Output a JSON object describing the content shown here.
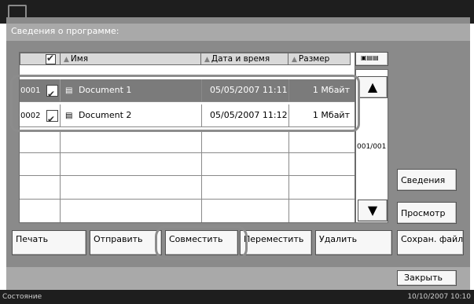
{
  "window": {
    "title": "Сведения о программе:"
  },
  "list": {
    "headers": {
      "name": "Имя",
      "datetime": "Дата и время",
      "size": "Размер"
    },
    "rows": [
      {
        "number": "0001",
        "checked": true,
        "name": "Document 1",
        "datetime": "05/05/2007 11:11",
        "size": "1 Мбайт",
        "selected": true
      },
      {
        "number": "0002",
        "checked": true,
        "name": "Document 2",
        "datetime": "05/05/2007 11:12",
        "size": "1 Мбайт",
        "selected": false
      }
    ],
    "page_indicator": "001/001"
  },
  "side_buttons": {
    "details": "Сведения",
    "preview": "Просмотр"
  },
  "action_buttons": {
    "print": "Печать",
    "send": "Отправить",
    "combine": "Совместить",
    "move": "Переместить",
    "delete": "Удалить",
    "save_file": "Сохран. файл"
  },
  "close_button": "Закрыть",
  "status": {
    "label": "Состояние",
    "datetime": "10/10/2007 10:10"
  }
}
